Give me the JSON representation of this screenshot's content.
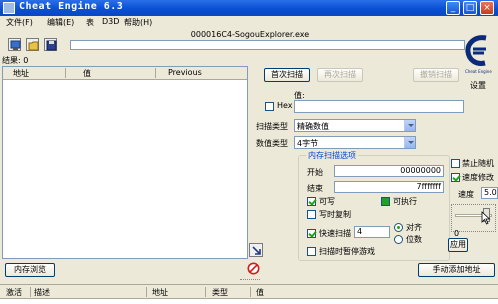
{
  "window": {
    "title": "Cheat Engine 6.3"
  },
  "menu": [
    "文件(F)",
    "编辑(E)",
    "表",
    "D3D",
    "帮助(H)"
  ],
  "process_name": "000016C4-SogouExplorer.exe",
  "results_label": "结果: 0",
  "list_headers": {
    "address": "地址",
    "value": "值",
    "previous": "Previous"
  },
  "scan": {
    "first_scan": "首次扫描",
    "next_scan": "再次扫描",
    "undo_scan": "撤销扫描",
    "value_label": "值:",
    "hex_label": "Hex",
    "scan_type_label": "扫描类型",
    "scan_type_value": "精确数值",
    "value_type_label": "数值类型",
    "value_type_value": "4字节"
  },
  "memory_options": {
    "title": "内存扫描选项",
    "start_label": "开始",
    "start_value": "00000000",
    "stop_label": "结束",
    "stop_value": "7fffffff",
    "writable": "可写",
    "executable": "可执行",
    "copy_on_write": "写时复制",
    "fast_scan": "快速扫描",
    "fast_scan_value": "4",
    "align": "对齐",
    "last_digits": "位数",
    "pause_game": "扫描时暂停游戏"
  },
  "right_options": {
    "disable_random": "禁止随机",
    "speedhack": "速度修改",
    "speed_label": "速度",
    "speed_value": "5.0",
    "slider_value": "0",
    "apply": "应用"
  },
  "settings_label": "设置",
  "memory_view_button": "内存浏览",
  "add_address_button": "手动添加地址",
  "table_headers": {
    "active": "激活",
    "description": "描述",
    "address": "地址",
    "type": "类型",
    "value": "值"
  }
}
